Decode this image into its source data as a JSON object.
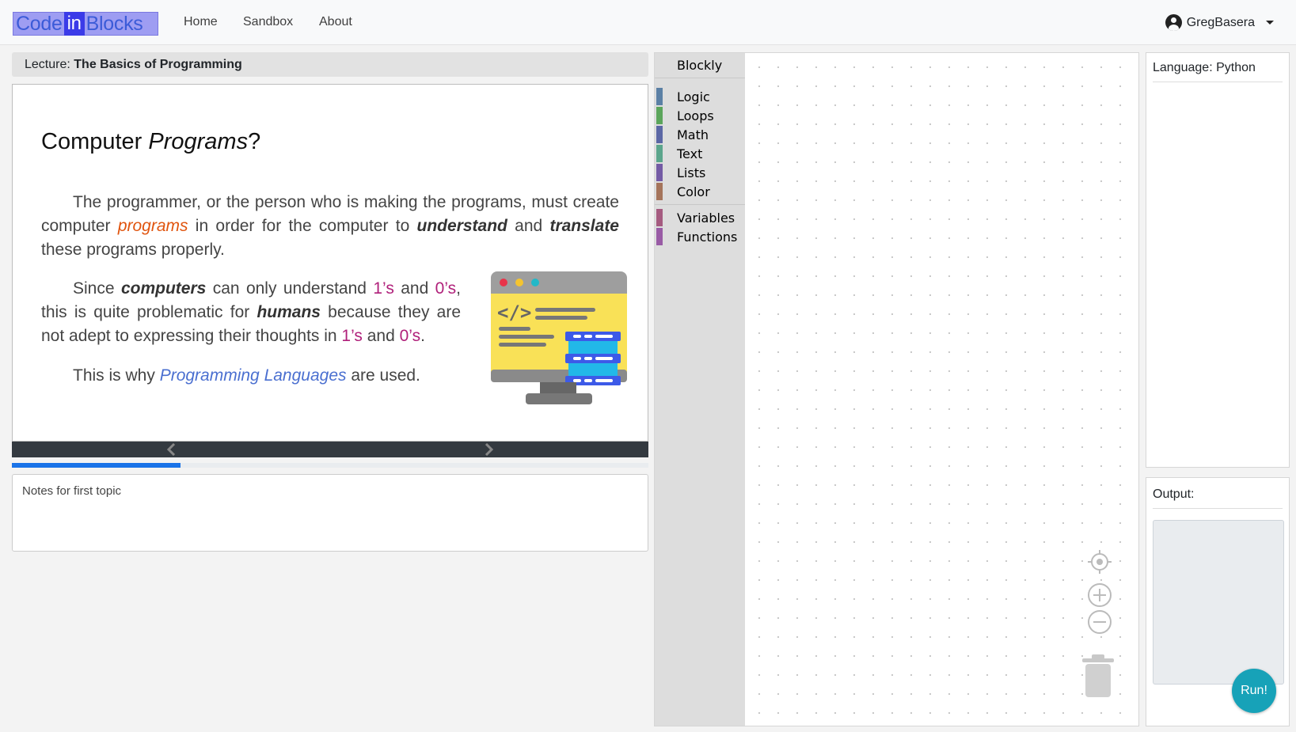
{
  "navbar": {
    "brand_code": "Code",
    "brand_in": "in",
    "brand_blocks": "Blocks",
    "links": [
      "Home",
      "Sandbox",
      "About"
    ],
    "user_name": "GregBasera"
  },
  "lecture": {
    "prefix": "Lecture:",
    "title": "The Basics of Programming"
  },
  "slide": {
    "heading_plain": "Computer ",
    "heading_italic": "Programs",
    "heading_end": "?",
    "p1": {
      "a": "The programmer, or the person who is making the programs, must create computer ",
      "programs": "programs",
      "b": " in order for the computer to ",
      "understand": "understand",
      "c": " and ",
      "translate": "translate",
      "d": " these programs properly."
    },
    "p2": {
      "a": "Since ",
      "computers": "computers",
      "b": " can only understand ",
      "ones1": "1’s",
      "c": " and ",
      "zeros1": "0’s",
      "d": ", this is quite problematic for ",
      "humans": "humans",
      "e": " because they are not adept to expressing their thoughts in ",
      "ones2": "1’s",
      "f": " and ",
      "zeros2": "0’s",
      "g": "."
    },
    "p3": {
      "a": "This is why ",
      "langs": "Programming Languages",
      "b": " are used."
    },
    "progress_fraction": 0.265
  },
  "notes": "Notes for first topic",
  "blockly": {
    "title": "Blockly",
    "categories": [
      {
        "label": "Logic",
        "color": "#5b80a5"
      },
      {
        "label": "Loops",
        "color": "#5ba55b"
      },
      {
        "label": "Math",
        "color": "#5b67a5"
      },
      {
        "label": "Text",
        "color": "#5ba58c"
      },
      {
        "label": "Lists",
        "color": "#745ba5"
      },
      {
        "label": "Color",
        "color": "#a5745b"
      },
      {
        "label": "Variables",
        "color": "#a55b80"
      },
      {
        "label": "Functions",
        "color": "#995ba5"
      }
    ]
  },
  "language_panel": {
    "label": "Language: Python"
  },
  "output_panel": {
    "label": "Output:"
  },
  "run_button": "Run!"
}
